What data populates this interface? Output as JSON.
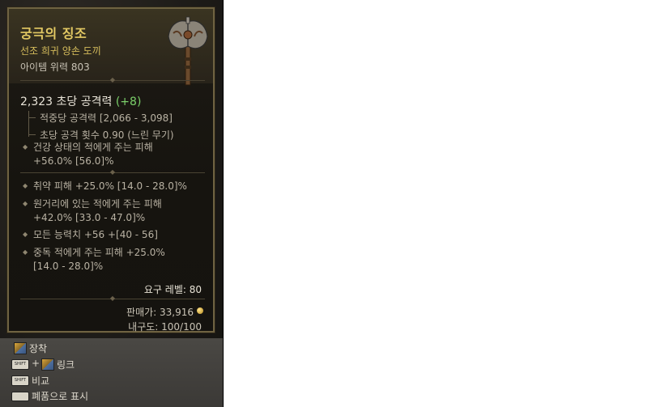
{
  "item": {
    "name": "궁극의 징조",
    "type": "선조 희귀 양손 도끼",
    "power": "아이템 위력 803",
    "dps_value": "2,323 초당 공격력",
    "dps_delta": "(+8)",
    "damage_per_hit": "적중당 공격력 [2,066 - 3,098]",
    "attacks_per_second": "초당 공격 횟수 0.90 (느린 무기)",
    "implicit_line1": "건강 상태의 적에게 주는 피해",
    "implicit_line2": "+56.0% [56.0]%",
    "affix1": "취약 피해 +25.0% [14.0 - 28.0]%",
    "affix2_line1": "원거리에 있는 적에게 주는 피해",
    "affix2_line2": "+42.0% [33.0 - 47.0]%",
    "affix3": "모든 능력치 +56 +[40 - 56]",
    "affix4_line1": "중독 적에게 주는 피해 +25.0%",
    "affix4_line2": "[14.0 - 28.0]%",
    "required_level": "요구 레벨: 80",
    "sell_value": "판매가: 33,916",
    "durability": "내구도: 100/100"
  },
  "colors": {
    "title": "#e2c863",
    "subtitle": "#d6bd5c",
    "positive": "#7bd06a",
    "frame": "#6f6342"
  },
  "footer": {
    "equip_label": "장착",
    "link_plus": "+",
    "link_label": "링크",
    "compare_label": "비교",
    "junk_label": "폐품으로 표시",
    "shift_key": "SHIFT",
    "icons": [
      "item-icon",
      "shift-key-icon",
      "space-key-icon"
    ]
  }
}
